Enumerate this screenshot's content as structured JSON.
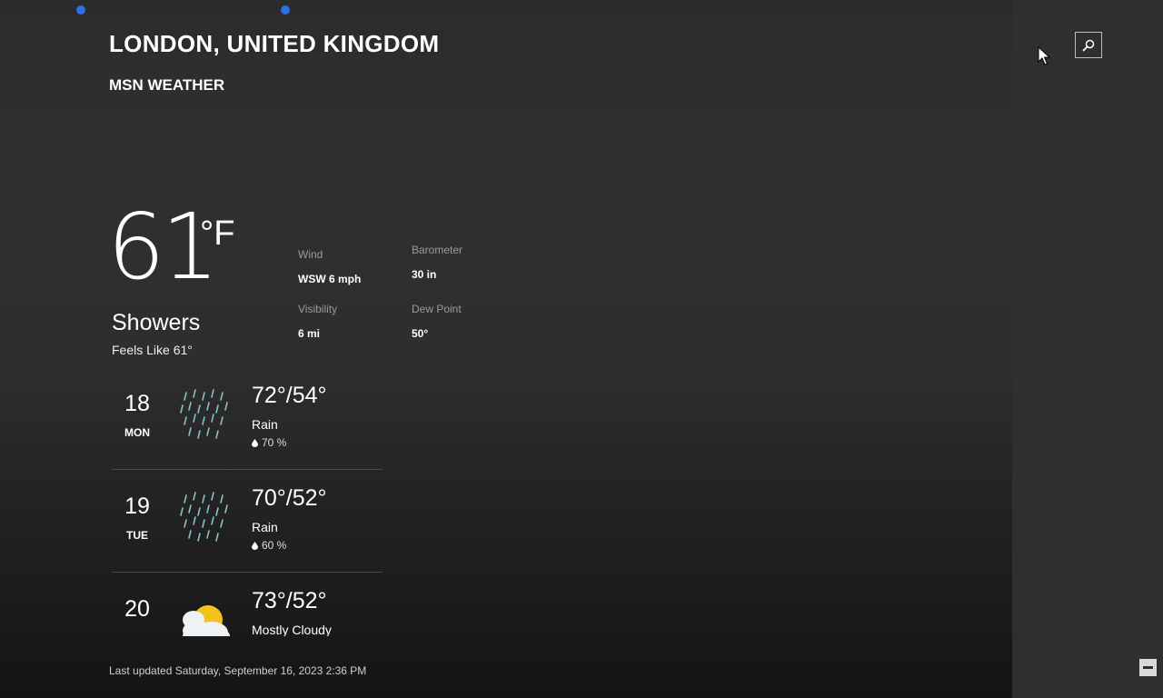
{
  "header": {
    "location": "LONDON, UNITED KINGDOM",
    "provider": "MSN WEATHER"
  },
  "current": {
    "temperature": "61",
    "unit": "°F",
    "condition": "Showers",
    "feels_like": "Feels Like 61°"
  },
  "details": {
    "wind_label": "Wind",
    "wind_value": "WSW 6 mph",
    "barometer_label": "Barometer",
    "barometer_value": "30 in",
    "visibility_label": "Visibility",
    "visibility_value": "6 mi",
    "dew_point_label": "Dew Point",
    "dew_point_value": "50°"
  },
  "forecast": [
    {
      "date": "18",
      "day": "MON",
      "hilo": "72°/54°",
      "condition": "Rain",
      "precip": "70 %",
      "icon": "rain-icon"
    },
    {
      "date": "19",
      "day": "TUE",
      "hilo": "70°/52°",
      "condition": "Rain",
      "precip": "60 %",
      "icon": "rain-icon"
    },
    {
      "date": "20",
      "day": "",
      "hilo": "73°/52°",
      "condition": "Mostly Cloudy",
      "precip": "",
      "icon": "mostly-cloudy-icon"
    }
  ],
  "footer": {
    "last_updated": "Last updated Saturday, September 16, 2023 2:36 PM"
  },
  "icons": {
    "search": "search-icon",
    "collapse": "minus-icon",
    "cursor": "cursor-icon"
  },
  "colors": {
    "accent_dot": "#2f6fe0",
    "rain": "#8fd3d8",
    "background": "#2e2e2e",
    "side_panel": "#2f2f2f"
  }
}
